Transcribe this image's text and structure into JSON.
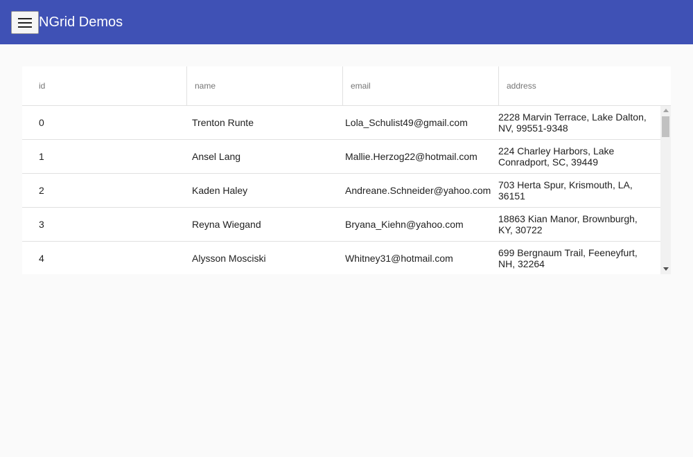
{
  "app": {
    "title": "NGrid Demos",
    "menu_icon": "hamburger-menu-icon"
  },
  "colors": {
    "toolbar": "#3f51b5",
    "background": "#fafafa",
    "grid_background": "#ffffff",
    "divider": "#e0e0e0"
  },
  "grid": {
    "columns": [
      "id",
      "name",
      "email",
      "address"
    ],
    "rows": [
      {
        "id": "0",
        "name": "Trenton Runte",
        "email": "Lola_Schulist49@gmail.com",
        "address": "2228 Marvin Terrace, Lake Dalton, NV, 99551-9348"
      },
      {
        "id": "1",
        "name": "Ansel Lang",
        "email": "Mallie.Herzog22@hotmail.com",
        "address": "224 Charley Harbors, Lake Conradport, SC, 39449"
      },
      {
        "id": "2",
        "name": "Kaden Haley",
        "email": "Andreane.Schneider@yahoo.com",
        "address": "703 Herta Spur, Krismouth, LA, 36151"
      },
      {
        "id": "3",
        "name": "Reyna Wiegand",
        "email": "Bryana_Kiehn@yahoo.com",
        "address": "18863 Kian Manor, Brownburgh, KY, 30722"
      },
      {
        "id": "4",
        "name": "Alysson Mosciski",
        "email": "Whitney31@hotmail.com",
        "address": "699 Bergnaum Trail, Feeneyfurt, NH, 32264"
      }
    ]
  }
}
